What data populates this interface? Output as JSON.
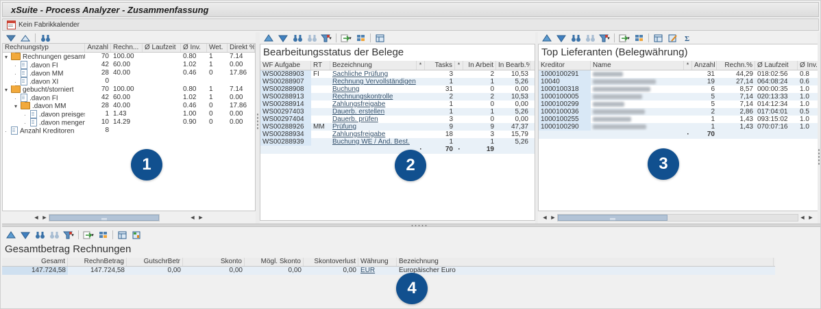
{
  "window": {
    "title": "xSuite - Process Analyzer - Zusammenfassung"
  },
  "infobar": {
    "label": "Kein Fabrikkalender"
  },
  "badges": {
    "one": "1",
    "two": "2",
    "three": "3",
    "four": "4"
  },
  "colors": {
    "badge": "#11508f",
    "total_row": "#ffff00",
    "row_alt": "#e9f1f8",
    "key_cell": "#d9e8f6",
    "link": "#33506b"
  },
  "icons": {
    "calendar": "calendar-grid",
    "collapse_all": "▼",
    "expand_all": "▲",
    "find": "binoculars",
    "find_next": "binoculars-light",
    "sort_asc": "▲",
    "sort_desc": "▼",
    "filter": "funnel+red-dot",
    "export": "sheet-green-arrow",
    "views": "grid",
    "detail_view": "table-blue",
    "change_layout": "table-pencil",
    "subtotal": "Σ",
    "dropdown": "▾"
  },
  "invoice_panel": {
    "columns": {
      "type": "Rechnungstyp",
      "anzahl": "Anzahl",
      "rechn": "Rechn...",
      "laufzeit": "Ø Laufzeit",
      "inv": "Ø Inv.",
      "wet": "Wet.",
      "direkt": "Direkt %"
    },
    "rows": [
      {
        "level": 0,
        "icon": "folder",
        "caret": "▾",
        "label": "Rechnungen gesamt",
        "anzahl": "70",
        "rechn": "100.00",
        "laufzeit": "",
        "inv": "0.80",
        "wet": "1",
        "direkt": "7.14"
      },
      {
        "level": 1,
        "icon": "doc",
        "caret": "·",
        "label": ".davon FI",
        "anzahl": "42",
        "rechn": "60.00",
        "laufzeit": "",
        "inv": "1.02",
        "wet": "1",
        "direkt": "0.00"
      },
      {
        "level": 1,
        "icon": "doc",
        "caret": "·",
        "label": ".davon MM",
        "anzahl": "28",
        "rechn": "40.00",
        "laufzeit": "",
        "inv": "0.46",
        "wet": "0",
        "direkt": "17.86"
      },
      {
        "level": 1,
        "icon": "doc",
        "caret": "·",
        "label": ".davon XI",
        "anzahl": "0",
        "rechn": "",
        "laufzeit": "",
        "inv": "",
        "wet": "",
        "direkt": ""
      },
      {
        "level": 0,
        "icon": "folder",
        "caret": "▾",
        "label": "gebucht/storniert",
        "anzahl": "70",
        "rechn": "100.00",
        "laufzeit": "",
        "inv": "0.80",
        "wet": "1",
        "direkt": "7.14"
      },
      {
        "level": 1,
        "icon": "doc",
        "caret": "·",
        "label": ".davon FI",
        "anzahl": "42",
        "rechn": "60.00",
        "laufzeit": "",
        "inv": "1.02",
        "wet": "1",
        "direkt": "0.00"
      },
      {
        "level": 1,
        "icon": "folder",
        "caret": "▾",
        "label": ".davon MM",
        "anzahl": "28",
        "rechn": "40.00",
        "laufzeit": "",
        "inv": "0.46",
        "wet": "0",
        "direkt": "17.86"
      },
      {
        "level": 2,
        "icon": "doc",
        "caret": "·",
        "label": ".davon preisgesperrt",
        "anzahl": "1",
        "rechn": "1.43",
        "laufzeit": "",
        "inv": "1.00",
        "wet": "0",
        "direkt": "0.00"
      },
      {
        "level": 2,
        "icon": "doc",
        "caret": "·",
        "label": ".davon mengengesperrt",
        "anzahl": "10",
        "rechn": "14.29",
        "laufzeit": "",
        "inv": "0.90",
        "wet": "0",
        "direkt": "0.00"
      },
      {
        "level": 0,
        "icon": "doc",
        "caret": "·",
        "label": "Anzahl Kreditoren",
        "anzahl": "8",
        "rechn": "",
        "laufzeit": "",
        "inv": "",
        "wet": "",
        "direkt": ""
      }
    ]
  },
  "status_panel": {
    "title": "Bearbeitungsstatus der Belege",
    "columns": {
      "wf": "WF Aufgabe",
      "rt": "RT",
      "name": "Bezeichnung",
      "star1": "*",
      "tasks": "Tasks",
      "star2": "*",
      "arbeit": "In Arbeit",
      "pct": "In Bearb.%"
    },
    "rows": [
      {
        "wf": "WS00288903",
        "rt": "FI",
        "name": "Sachliche Prüfung",
        "tasks": "3",
        "arbeit": "2",
        "pct": "10,53"
      },
      {
        "wf": "WS00288907",
        "rt": "",
        "name": "Rechnung Vervollständigen",
        "tasks": "1",
        "arbeit": "1",
        "pct": "5,26"
      },
      {
        "wf": "WS00288908",
        "rt": "",
        "name": "Buchung",
        "tasks": "31",
        "arbeit": "0",
        "pct": "0,00"
      },
      {
        "wf": "WS00288913",
        "rt": "",
        "name": "Rechnungskontrolle",
        "tasks": "2",
        "arbeit": "2",
        "pct": "10,53"
      },
      {
        "wf": "WS00288914",
        "rt": "",
        "name": "Zahlungsfreigabe",
        "tasks": "1",
        "arbeit": "0",
        "pct": "0,00"
      },
      {
        "wf": "WS00297403",
        "rt": "",
        "name": "Dauerb. erstellen",
        "tasks": "1",
        "arbeit": "1",
        "pct": "5,26"
      },
      {
        "wf": "WS00297404",
        "rt": "",
        "name": "Dauerb. prüfen",
        "tasks": "3",
        "arbeit": "0",
        "pct": "0,00"
      },
      {
        "wf": "WS00288926",
        "rt": "MM",
        "name": "Prüfung",
        "tasks": "9",
        "arbeit": "9",
        "pct": "47,37"
      },
      {
        "wf": "WS00288934",
        "rt": "",
        "name": "Zahlungsfreigabe",
        "tasks": "18",
        "arbeit": "3",
        "pct": "15,79"
      },
      {
        "wf": "WS00288939",
        "rt": "",
        "name": "Buchung WE / Änd. Best.",
        "tasks": "1",
        "arbeit": "1",
        "pct": "5,26"
      }
    ],
    "totals": {
      "star1": "·",
      "tasks": "70",
      "star2": "·",
      "arbeit": "19"
    }
  },
  "suppliers_panel": {
    "title": "Top Lieferanten (Belegwährung)",
    "columns": {
      "kreditor": "Kreditor",
      "name": "Name",
      "star": "*",
      "anzahl": "Anzahl",
      "pct": "Rechn.%",
      "laufzeit": "Ø Laufzeit",
      "inv": "Ø Inv."
    },
    "rows": [
      {
        "kreditor": "1000100291",
        "name_style": "width:44px",
        "anzahl": "31",
        "pct": "44,29",
        "laufzeit": "018:02:56",
        "inv": "0.8"
      },
      {
        "kreditor": "10040",
        "name_style": "width:92px",
        "anzahl": "19",
        "pct": "27,14",
        "laufzeit": "064:08:24",
        "inv": "0.6"
      },
      {
        "kreditor": "1000100318",
        "name_style": "width:84px",
        "anzahl": "6",
        "pct": "8,57",
        "laufzeit": "000:00:35",
        "inv": "1.0"
      },
      {
        "kreditor": "1000100005",
        "name_style": "width:72px",
        "anzahl": "5",
        "pct": "7,14",
        "laufzeit": "020:13:33",
        "inv": "1.0"
      },
      {
        "kreditor": "1000100299",
        "name_style": "width:46px",
        "anzahl": "5",
        "pct": "7,14",
        "laufzeit": "014:12:34",
        "inv": "1.0"
      },
      {
        "kreditor": "1000100036",
        "name_style": "width:76px",
        "anzahl": "2",
        "pct": "2,86",
        "laufzeit": "017:04:01",
        "inv": "0.5"
      },
      {
        "kreditor": "1000100255",
        "name_style": "width:56px",
        "anzahl": "1",
        "pct": "1,43",
        "laufzeit": "093:15:02",
        "inv": "1.0"
      },
      {
        "kreditor": "1000100290",
        "name_style": "width:78px",
        "anzahl": "1",
        "pct": "1,43",
        "laufzeit": "070:07:16",
        "inv": "1.0"
      }
    ],
    "totals": {
      "star": "·",
      "anzahl": "70"
    }
  },
  "amounts_panel": {
    "title": "Gesamtbetrag Rechnungen",
    "columns": {
      "gesamt": "Gesamt",
      "rechn": "RechnBetrag",
      "gutschr": "GutschrBetr",
      "skonto": "Skonto",
      "moegl": "Mögl. Skonto",
      "verlust": "Skontoverlust",
      "waehrung": "Währung",
      "bez": "Bezeichnung"
    },
    "row": {
      "gesamt": "147.724,58",
      "rechn": "147.724,58",
      "gutschr": "0,00",
      "skonto": "0,00",
      "moegl": "0,00",
      "verlust": "0,00",
      "waehrung": "EUR",
      "bez": "Europäischer Euro"
    }
  }
}
